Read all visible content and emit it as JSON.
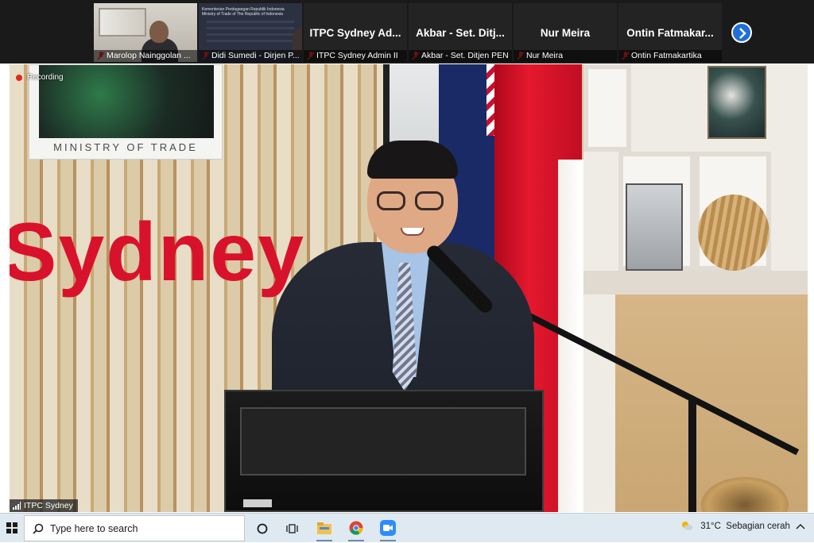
{
  "participants": [
    {
      "name": "Marolop Nainggolan ...",
      "title": "",
      "type": "video"
    },
    {
      "name": "Didi Sumedi - Dirjen P...",
      "title": "",
      "type": "slide",
      "slide_text": "Kementerian Perdagangan Republik Indonesia\nMinistry of Trade of The Republic of Indonesia"
    },
    {
      "name": "ITPC Sydney Admin II",
      "title": "ITPC Sydney Ad...",
      "type": "name"
    },
    {
      "name": "Akbar - Set. Ditjen PEN",
      "title": "Akbar - Set. Ditj...",
      "type": "name"
    },
    {
      "name": "Nur Meira",
      "title": "Nur Meira",
      "type": "name"
    },
    {
      "name": "Ontin Fatmakartika",
      "title": "Ontin Fatmakar...",
      "type": "name"
    }
  ],
  "next_page_icon": "chevron-right-icon",
  "main_video": {
    "recording_label": "Recording",
    "speaker_name": "ITPC Sydney",
    "plaque_text": "MINISTRY OF TRADE",
    "wall_text": "Sydney"
  },
  "taskbar": {
    "search_placeholder": "Type here to search",
    "weather_temp": "31°C",
    "weather_text": "Sebagian cerah",
    "icons": [
      "windows-start-icon",
      "cortana-icon",
      "task-view-icon",
      "file-explorer-icon",
      "chrome-icon",
      "zoom-icon"
    ]
  },
  "colors": {
    "accent_blue": "#1e6fd9",
    "mic_muted_red": "#e3281d",
    "sydney_red": "#d9122b"
  }
}
